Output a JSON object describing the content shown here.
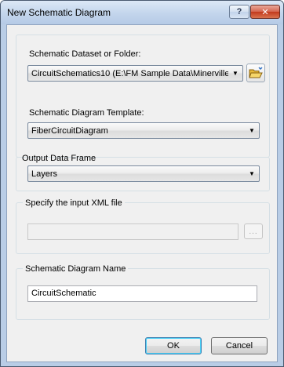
{
  "window": {
    "title": "New Schematic Diagram",
    "help_label": "?",
    "close_label": "✕"
  },
  "dataset": {
    "label": "Schematic Dataset or Folder:",
    "value": "CircuitSchematics10 (E:\\FM Sample Data\\Minerville",
    "browse_icon": "open-folder-icon"
  },
  "template": {
    "label": "Schematic Diagram Template:",
    "value": "FiberCircuitDiagram"
  },
  "output": {
    "label": "Output Data Frame",
    "value": "Layers"
  },
  "xml": {
    "label": "Specify the input XML file",
    "value": "",
    "browse_label": "..."
  },
  "name": {
    "label": "Schematic Diagram Name",
    "value": "CircuitSchematic"
  },
  "buttons": {
    "ok": "OK",
    "cancel": "Cancel"
  }
}
